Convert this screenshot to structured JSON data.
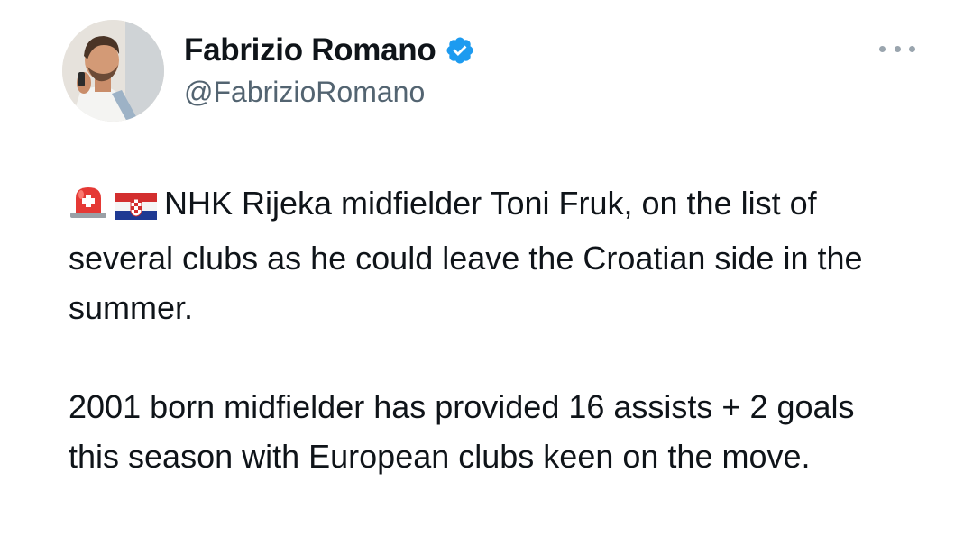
{
  "tweet": {
    "author": {
      "display_name": "Fabrizio Romano",
      "handle": "@FabrizioRomano",
      "verified": true,
      "avatar_icon": "profile-photo"
    },
    "menu_icon": "more-options-icon",
    "paragraphs": [
      {
        "leading_icons": [
          "siren-emoji",
          "croatia-flag-emoji"
        ],
        "text": "NHK Rijeka midfielder Toni Fruk, on the list of several clubs as he could leave the Croatian side in the summer."
      },
      {
        "text": "2001 born midfielder has provided 16 assists + 2 goals this season with European clubs keen on the move."
      }
    ]
  },
  "colors": {
    "text_primary": "#0f1419",
    "text_secondary": "#536471",
    "verified_blue": "#1d9bf0",
    "background": "#ffffff"
  }
}
